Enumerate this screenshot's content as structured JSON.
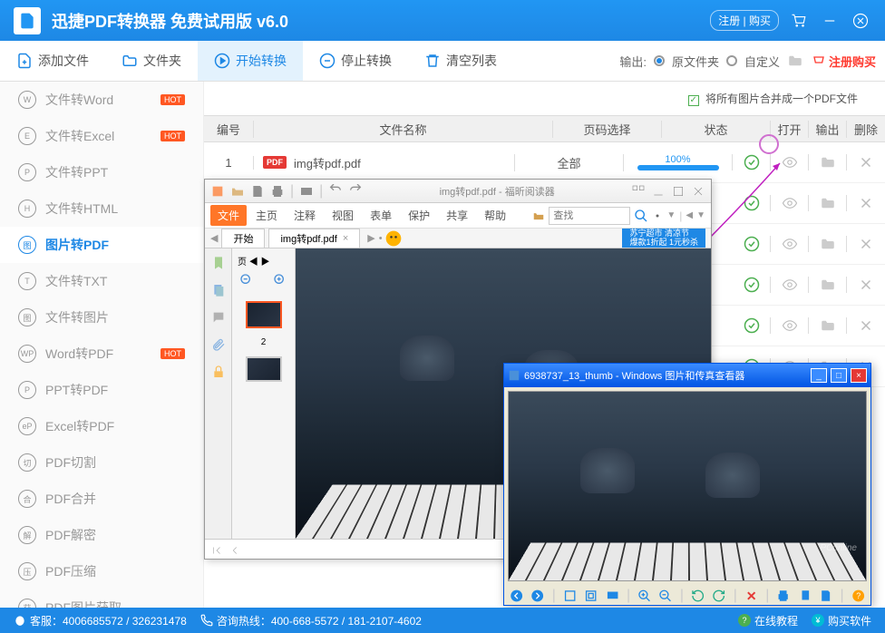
{
  "titlebar": {
    "title": "迅捷PDF转换器 免费试用版 v6.0",
    "register": "注册 | 购买"
  },
  "toolbar": {
    "add_file": "添加文件",
    "add_folder": "文件夹",
    "start": "开始转换",
    "stop": "停止转换",
    "clear": "清空列表",
    "output_label": "输出:",
    "output_src": "原文件夹",
    "output_custom": "自定义",
    "buy": "注册购买"
  },
  "sidebar": {
    "items": [
      {
        "icon": "W",
        "label": "文件转Word",
        "hot": true
      },
      {
        "icon": "E",
        "label": "文件转Excel",
        "hot": true
      },
      {
        "icon": "P",
        "label": "文件转PPT"
      },
      {
        "icon": "H",
        "label": "文件转HTML"
      },
      {
        "icon": "图",
        "label": "图片转PDF",
        "selected": true
      },
      {
        "icon": "T",
        "label": "文件转TXT"
      },
      {
        "icon": "图",
        "label": "文件转图片"
      },
      {
        "icon": "WP",
        "label": "Word转PDF",
        "hot": true
      },
      {
        "icon": "P",
        "label": "PPT转PDF"
      },
      {
        "icon": "eP",
        "label": "Excel转PDF"
      },
      {
        "icon": "切",
        "label": "PDF切割"
      },
      {
        "icon": "合",
        "label": "PDF合并"
      },
      {
        "icon": "解",
        "label": "PDF解密"
      },
      {
        "icon": "压",
        "label": "PDF压缩"
      },
      {
        "icon": "获",
        "label": "PDF图片获取"
      }
    ]
  },
  "content": {
    "merge_checkbox": "将所有图片合并成一个PDF文件",
    "headers": {
      "idx": "编号",
      "name": "文件名称",
      "page": "页码选择",
      "status": "状态",
      "open": "打开",
      "out": "输出",
      "del": "删除"
    },
    "rows": [
      {
        "idx": "1",
        "name": "img转pdf.pdf",
        "page": "全部",
        "pct": "100%"
      }
    ]
  },
  "pdf_reader": {
    "title": "img转pdf.pdf - 福昕阅读器",
    "menu": [
      "文件",
      "主页",
      "注释",
      "视图",
      "表单",
      "保护",
      "共享",
      "帮助"
    ],
    "search_placeholder": "查找",
    "tab_start": "开始",
    "tab_doc": "img转pdf.pdf",
    "ad_line1": "苏宁超市 清凉节",
    "ad_line2": "爆款1折起 1元秒杀",
    "page_label": "页",
    "thumb2_num": "2"
  },
  "img_viewer": {
    "title": "6938737_13_thumb - Windows 图片和传真查看器",
    "watermark": "PConline"
  },
  "footer": {
    "qq": "客服：4006685572 / 326231478",
    "hotline": "咨询热线：400-668-5572 / 181-2107-4602",
    "tutorial": "在线教程",
    "buy": "购买软件"
  }
}
